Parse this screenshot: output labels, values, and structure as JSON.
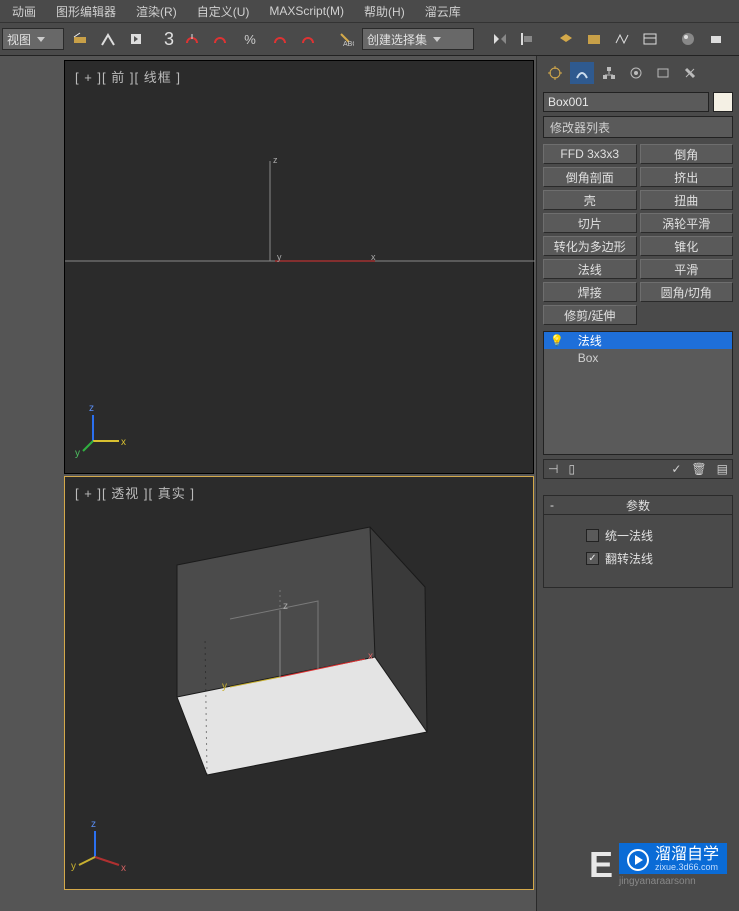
{
  "menu": {
    "items": [
      "动画",
      "图形编辑器",
      "渲染(R)",
      "自定义(U)",
      "MAXScript(M)",
      "帮助(H)",
      "溜云库"
    ]
  },
  "toolbar": {
    "view_dd": "视图",
    "snap_num": "3",
    "selset_dd": "创建选择集"
  },
  "viewports": {
    "top_label": "[ + ][ 前 ][ 线框 ]",
    "bottom_label": "[ + ][ 透视 ][ 真实 ]"
  },
  "panel": {
    "object_name": "Box001",
    "modlist_label": "修改器列表",
    "buttons": [
      "FFD 3x3x3",
      "倒角",
      "倒角剖面",
      "挤出",
      "壳",
      "扭曲",
      "切片",
      "涡轮平滑",
      "转化为多边形",
      "锥化",
      "法线",
      "平滑",
      "焊接",
      "圆角/切角"
    ],
    "extra_button": "修剪/延伸",
    "stack": [
      {
        "label": "法线",
        "selected": true,
        "bulb": true
      },
      {
        "label": "Box",
        "selected": false,
        "bulb": false
      }
    ],
    "rollout": {
      "title": "参数",
      "chk_unify": "统一法线",
      "chk_unify_val": false,
      "chk_flip": "翻转法线",
      "chk_flip_val": true
    }
  },
  "watermark": {
    "brand": "溜溜自学",
    "site": "zixue.3d66.com",
    "bottom": "jingyanaraarsonn"
  },
  "chart_data": null
}
